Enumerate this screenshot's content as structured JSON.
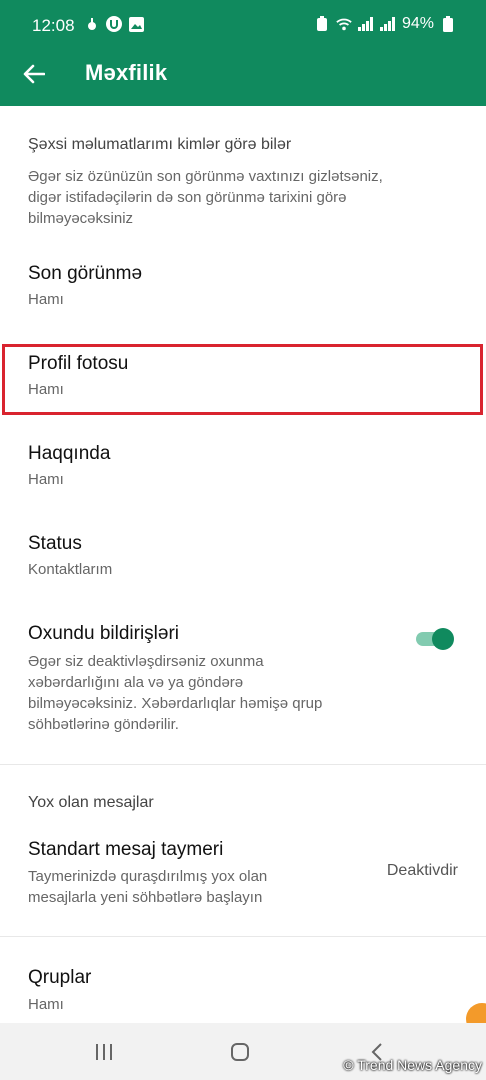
{
  "status_bar": {
    "time": "12:08",
    "battery": "94%"
  },
  "app_bar": {
    "title": "Məxfilik",
    "back_icon": "arrow-left-icon"
  },
  "section_visibility": {
    "header": "Şəxsi məlumatlarımı kimlər görə bilər",
    "description": [
      "Əgər siz özünüzün son görünmə vaxtınızı gizlətsəniz,",
      "digər istifadəçilərin də son görünmə tarixini görə",
      "bilməyəcəksiniz"
    ]
  },
  "settings": {
    "last_seen": {
      "title": "Son görünmə",
      "value": "Hamı"
    },
    "profile_photo": {
      "title": "Profil fotosu",
      "value": "Hamı"
    },
    "about": {
      "title": "Haqqında",
      "value": "Hamı"
    },
    "status": {
      "title": "Status",
      "value": "Kontaktlarım"
    },
    "read_receipts": {
      "title": "Oxundu bildirişləri",
      "enabled": true,
      "description": [
        "Əgər siz deaktivləşdirsəniz oxunma",
        "xəbərdarlığını ala və ya göndərə",
        "bilməyəcəksiniz. Xəbərdarlıqlar həmişə qrup",
        "söhbətlərinə göndərilir."
      ]
    }
  },
  "section_disappearing": {
    "header": "Yox olan mesajlar",
    "default_timer": {
      "title": "Standart mesaj taymeri",
      "description": [
        "Taymerinizdə quraşdırılmış yox olan",
        "mesajlarla yeni söhbətlərə başlayın"
      ],
      "value": "Deaktivdir"
    }
  },
  "groups": {
    "title": "Qruplar",
    "value": "Hamı"
  },
  "nav_bar": {
    "recents_icon": "recents-icon",
    "home_icon": "home-icon",
    "back_icon": "back-chevron-icon"
  },
  "watermark": "© Trend News Agency",
  "colors": {
    "primary": "#108a5e",
    "highlight_border": "#d9232f",
    "toggle_track": "#82cbb0"
  }
}
